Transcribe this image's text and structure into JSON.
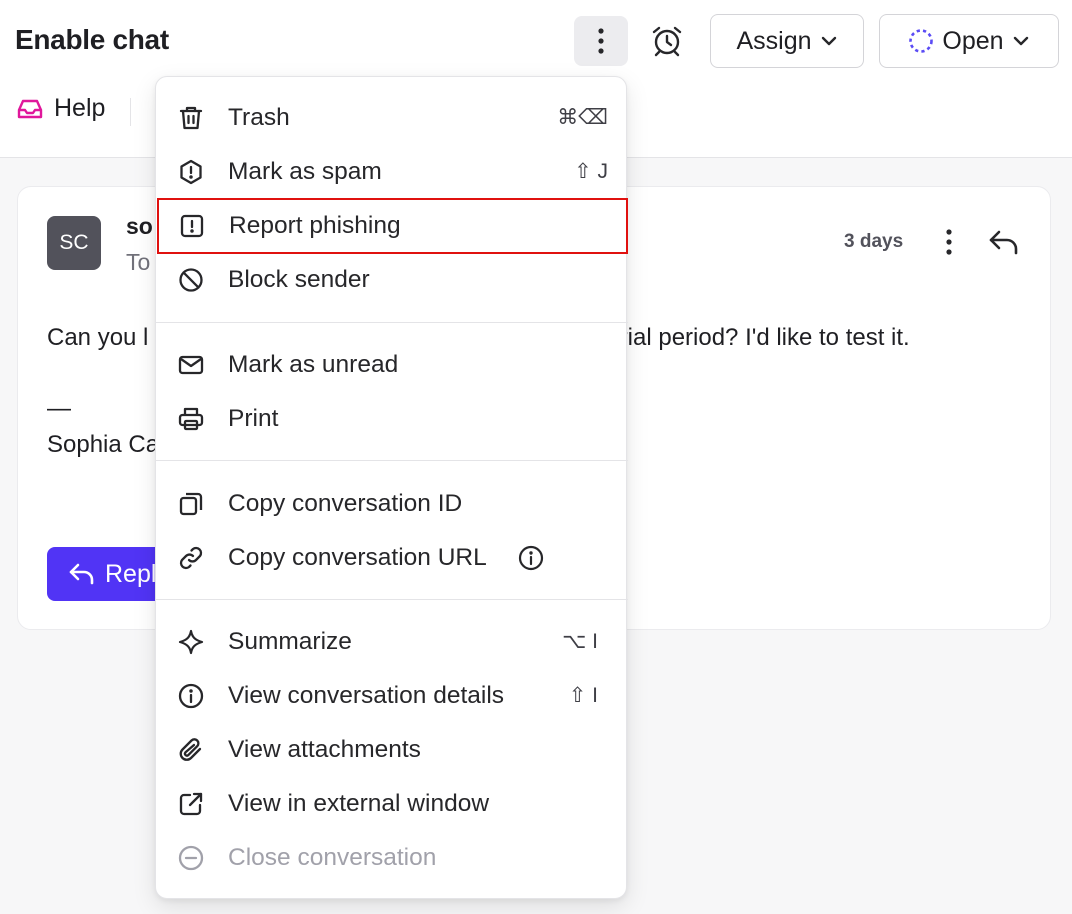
{
  "header": {
    "title": "Enable chat",
    "assign_label": "Assign",
    "status_label": "Open",
    "inbox_label": "Help",
    "inbox_color": "#e0179b",
    "status_color": "#5b4cf5"
  },
  "conversation": {
    "avatar_initials": "SC",
    "sender_partial": "so",
    "recipient_partial": "To",
    "time": "3 days",
    "body_start": "Can you l",
    "body_end": "trial period? I'd like to test it.",
    "signature_dash": "—",
    "signature_name": "Sophia Ca",
    "reply_label": "Repl",
    "reply_color": "#5134f5"
  },
  "menu": {
    "items": [
      {
        "label": "Trash",
        "icon": "trash-icon",
        "shortcut": "⌘⌫"
      },
      {
        "label": "Mark as spam",
        "icon": "spam-hexagon-icon",
        "shortcut": "⇧ J"
      },
      {
        "label": "Report phishing",
        "icon": "report-phishing-icon",
        "shortcut": ""
      },
      {
        "label": "Block sender",
        "icon": "block-icon",
        "shortcut": ""
      },
      {
        "label": "Mark as unread",
        "icon": "envelope-icon",
        "shortcut": ""
      },
      {
        "label": "Print",
        "icon": "printer-icon",
        "shortcut": ""
      },
      {
        "label": "Copy conversation ID",
        "icon": "copy-icon",
        "shortcut": ""
      },
      {
        "label": "Copy conversation URL",
        "icon": "link-icon",
        "shortcut": ""
      },
      {
        "label": "Summarize",
        "icon": "sparkle-icon",
        "shortcut": "⌥ I"
      },
      {
        "label": "View conversation details",
        "icon": "info-icon",
        "shortcut": "⇧ I"
      },
      {
        "label": "View attachments",
        "icon": "paperclip-icon",
        "shortcut": ""
      },
      {
        "label": "View in external window",
        "icon": "external-window-icon",
        "shortcut": ""
      },
      {
        "label": "Close conversation",
        "icon": "minus-circle-icon",
        "shortcut": "",
        "disabled": true
      }
    ],
    "highlight_color": "#e0110f"
  }
}
